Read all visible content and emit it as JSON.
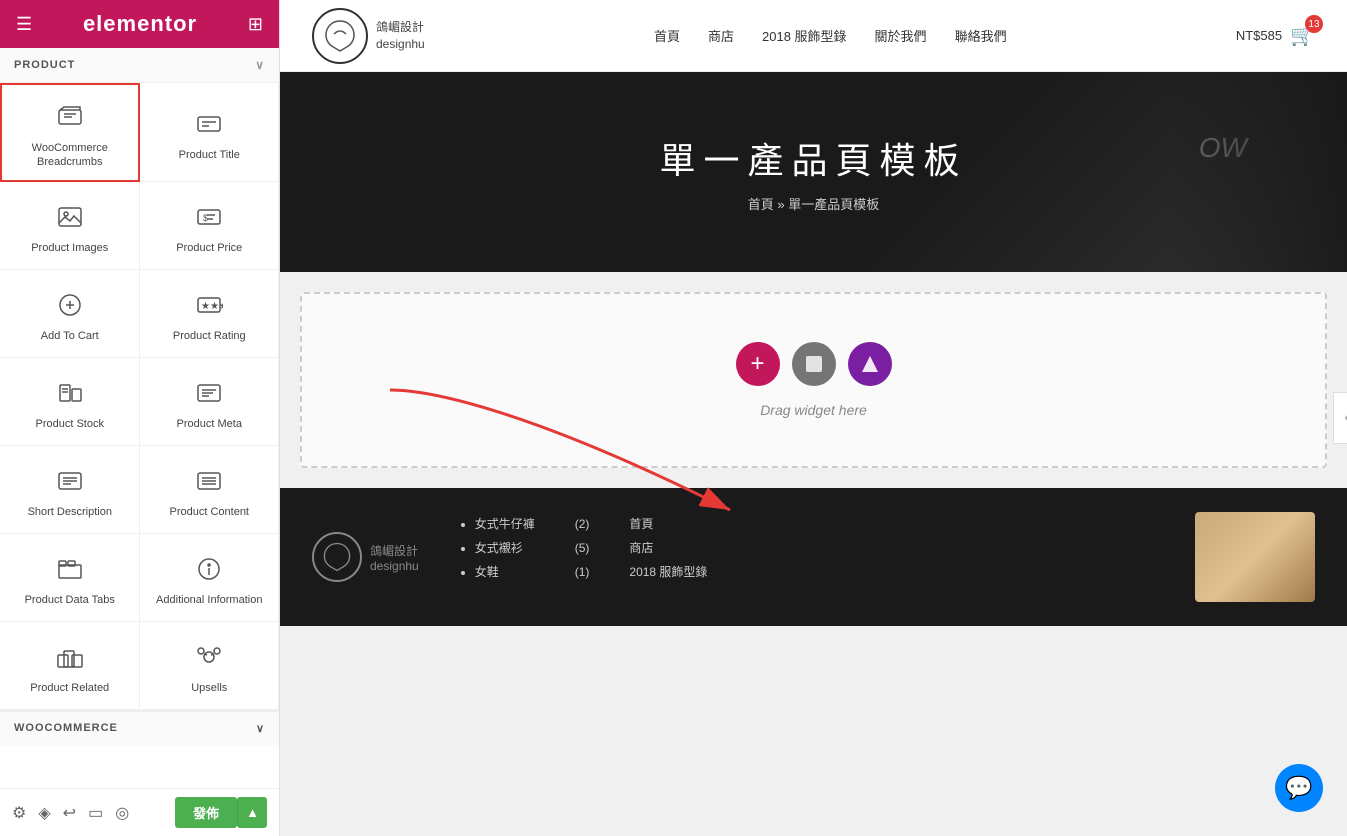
{
  "sidebar": {
    "header": {
      "logo": "elementor",
      "hamburger_icon": "☰",
      "grid_icon": "⊞"
    },
    "product_section": {
      "label": "PRODUCT",
      "chevron": "∨"
    },
    "widgets": [
      {
        "id": "woocommerce-breadcrumbs",
        "label": "WooCommerce\nBreadcrumbs",
        "selected": true
      },
      {
        "id": "product-title",
        "label": "Product Title",
        "selected": false
      },
      {
        "id": "product-images",
        "label": "Product Images",
        "selected": false
      },
      {
        "id": "product-price",
        "label": "Product Price",
        "selected": false
      },
      {
        "id": "add-to-cart",
        "label": "Add To Cart",
        "selected": false
      },
      {
        "id": "product-rating",
        "label": "Product Rating",
        "selected": false
      },
      {
        "id": "product-stock",
        "label": "Product Stock",
        "selected": false
      },
      {
        "id": "product-meta",
        "label": "Product Meta",
        "selected": false
      },
      {
        "id": "short-description",
        "label": "Short Description",
        "selected": false
      },
      {
        "id": "product-content",
        "label": "Product Content",
        "selected": false
      },
      {
        "id": "product-data-tabs",
        "label": "Product Data Tabs",
        "selected": false
      },
      {
        "id": "additional-information",
        "label": "Additional Information",
        "selected": false
      },
      {
        "id": "product-related",
        "label": "Product Related",
        "selected": false
      },
      {
        "id": "upsells",
        "label": "Upsells",
        "selected": false
      }
    ],
    "woo_section": {
      "label": "WOOCOMMERCE",
      "chevron": "∨"
    },
    "footer": {
      "publish_label": "發佈",
      "icons": [
        "settings",
        "layers",
        "undo",
        "responsive",
        "eye"
      ]
    }
  },
  "topnav": {
    "logo_icon": "🔔",
    "logo_name": "鴿嵋設計\ndesignhu",
    "links": [
      "首頁",
      "商店",
      "2018 服飾型錄",
      "關於我們",
      "聯絡我們"
    ],
    "cart_price": "NT$585",
    "cart_badge": "13"
  },
  "hero": {
    "title": "單一產品頁模板",
    "breadcrumb": "首頁 » 單一產品頁模板",
    "decoration": "OW"
  },
  "drag_area": {
    "text": "Drag widget here",
    "add_icon": "+",
    "circle_icon": "■",
    "arrow_icon": "▲"
  },
  "footer": {
    "logo_name": "鴿嵋設計\ndesignhu",
    "links": [
      "女式牛仔褲",
      "女式襯衫",
      "女鞋"
    ],
    "counts": [
      "(2)",
      "(5)",
      "(1)"
    ],
    "nav": [
      "首頁",
      "商店",
      "2018 服飾型錄"
    ]
  },
  "messenger_icon": "💬",
  "collapse_icon": "‹"
}
